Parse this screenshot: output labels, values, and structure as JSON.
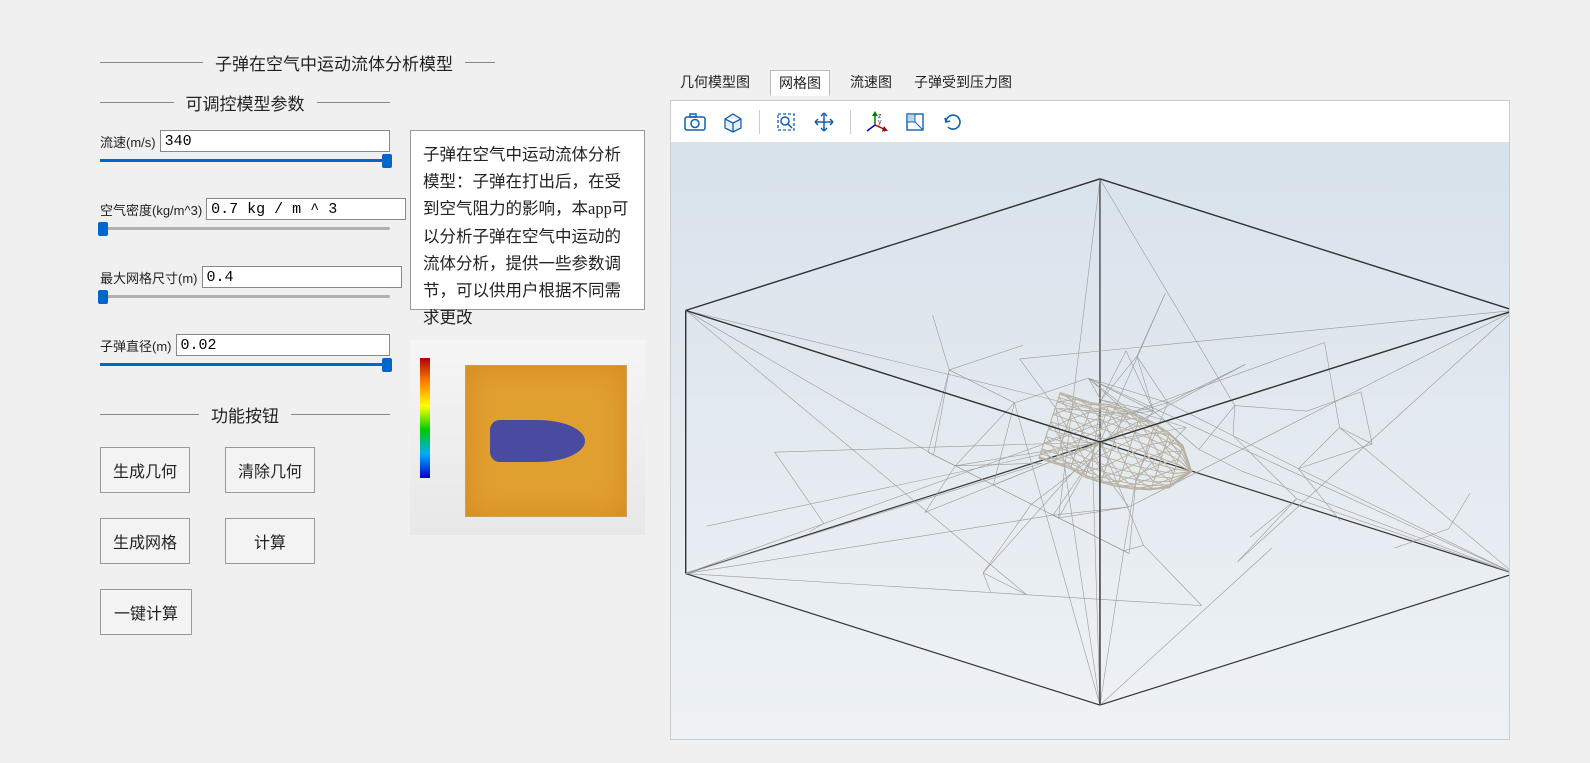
{
  "title": "子弹在空气中运动流体分析模型",
  "params_heading": "可调控模型参数",
  "buttons_heading": "功能按钮",
  "params": {
    "velocity": {
      "label": "流速(m/s)",
      "value": "340",
      "slider_pct": 99
    },
    "air_density": {
      "label": "空气密度(kg/m^3)",
      "value": "0.7 kg / m ^ 3",
      "slider_pct": 1
    },
    "mesh_size": {
      "label": "最大网格尺寸(m)",
      "value": "0.4",
      "slider_pct": 1
    },
    "diameter": {
      "label": "子弹直径(m)",
      "value": "0.02",
      "slider_pct": 99
    }
  },
  "description": "子弹在空气中运动流体分析模型：子弹在打出后，在受到空气阻力的影响，本app可以分析子弹在空气中运动的流体分析，提供一些参数调节，可以供用户根据不同需求更改",
  "buttons": {
    "gen_geom": "生成几何",
    "clear_geom": "清除几何",
    "gen_mesh": "生成网格",
    "compute": "计算",
    "one_click": "一键计算"
  },
  "tabs": {
    "geom": "几何模型图",
    "mesh": "网格图",
    "velocity": "流速图",
    "pressure": "子弹受到压力图",
    "active": "mesh"
  },
  "toolbar_icons": {
    "screenshot": "screenshot-icon",
    "print": "print-box-icon",
    "zoom_extents": "zoom-extents-icon",
    "pan": "pan-arrows-icon",
    "axes": "axes-xyz-icon",
    "view_xy": "view-plane-icon",
    "reset_rotate": "reset-rotation-icon"
  }
}
